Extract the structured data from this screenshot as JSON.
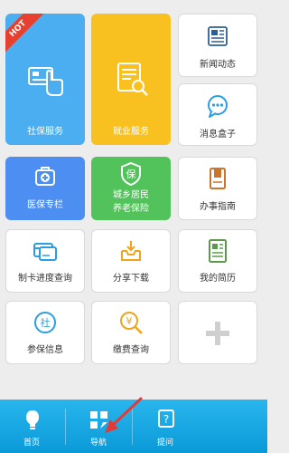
{
  "tiles": {
    "social_security": {
      "label": "社保服务",
      "badge": "HOT",
      "color": "#4aaef0"
    },
    "employment": {
      "label": "就业服务",
      "color": "#f8c11f"
    },
    "news": {
      "label": "新闻动态"
    },
    "message_box": {
      "label": "消息盒子"
    },
    "medical": {
      "label": "医保专栏",
      "color": "#4c8ef2"
    },
    "urban_rural": {
      "label_line1": "城乡居民",
      "label_line2": "养老保险",
      "color": "#52c25a"
    },
    "guide": {
      "label": "办事指南"
    },
    "card_progress": {
      "label": "制卡进度查询"
    },
    "share_download": {
      "label": "分享下载"
    },
    "resume": {
      "label": "我的简历"
    },
    "insurance_info": {
      "label": "参保信息"
    },
    "payment_query": {
      "label": "缴费查询"
    },
    "add": {
      "label": ""
    }
  },
  "nav": {
    "home": {
      "label": "首页"
    },
    "navigation": {
      "label": "导航"
    },
    "questions": {
      "label": "提问"
    }
  },
  "colors": {
    "accent": "#1aa7e4",
    "annotation_arrow": "#e53935"
  }
}
